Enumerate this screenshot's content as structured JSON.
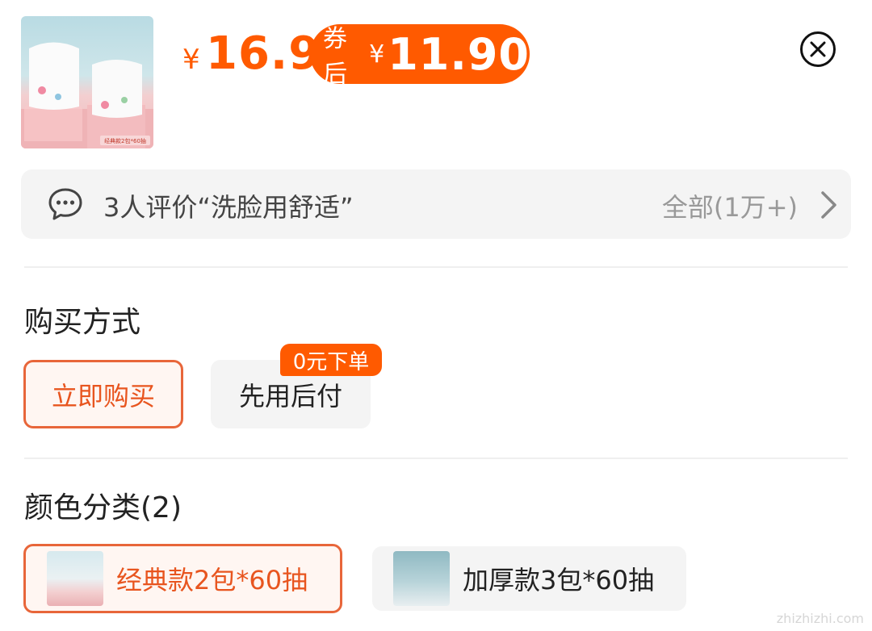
{
  "header": {
    "product_image": "product-image",
    "image_caption": "经典款2包*60抽",
    "price_currency": "¥",
    "price": "16.9",
    "coupon_label": "券后",
    "coupon_currency": "¥",
    "coupon_price": "11.90",
    "close_icon": "close-circle-icon"
  },
  "review": {
    "icon": "chat-bubble-icon",
    "text": "3人评价“洗脸用舒适”",
    "all_label": "全部(1万+)",
    "chevron": "chevron-right-icon"
  },
  "purchase": {
    "title": "购买方式",
    "options": [
      {
        "label": "立即购买",
        "selected": true
      },
      {
        "label": "先用后付",
        "selected": false,
        "badge": "0元下单"
      }
    ]
  },
  "color": {
    "title": "颜色分类(2)",
    "options": [
      {
        "label": "经典款2包*60抽",
        "selected": true
      },
      {
        "label": "加厚款3包*60抽",
        "selected": false
      }
    ]
  },
  "watermark": "zhizhizhi.com",
  "colors": {
    "accent": "#ff5a00",
    "selected_border": "#e8663a"
  }
}
